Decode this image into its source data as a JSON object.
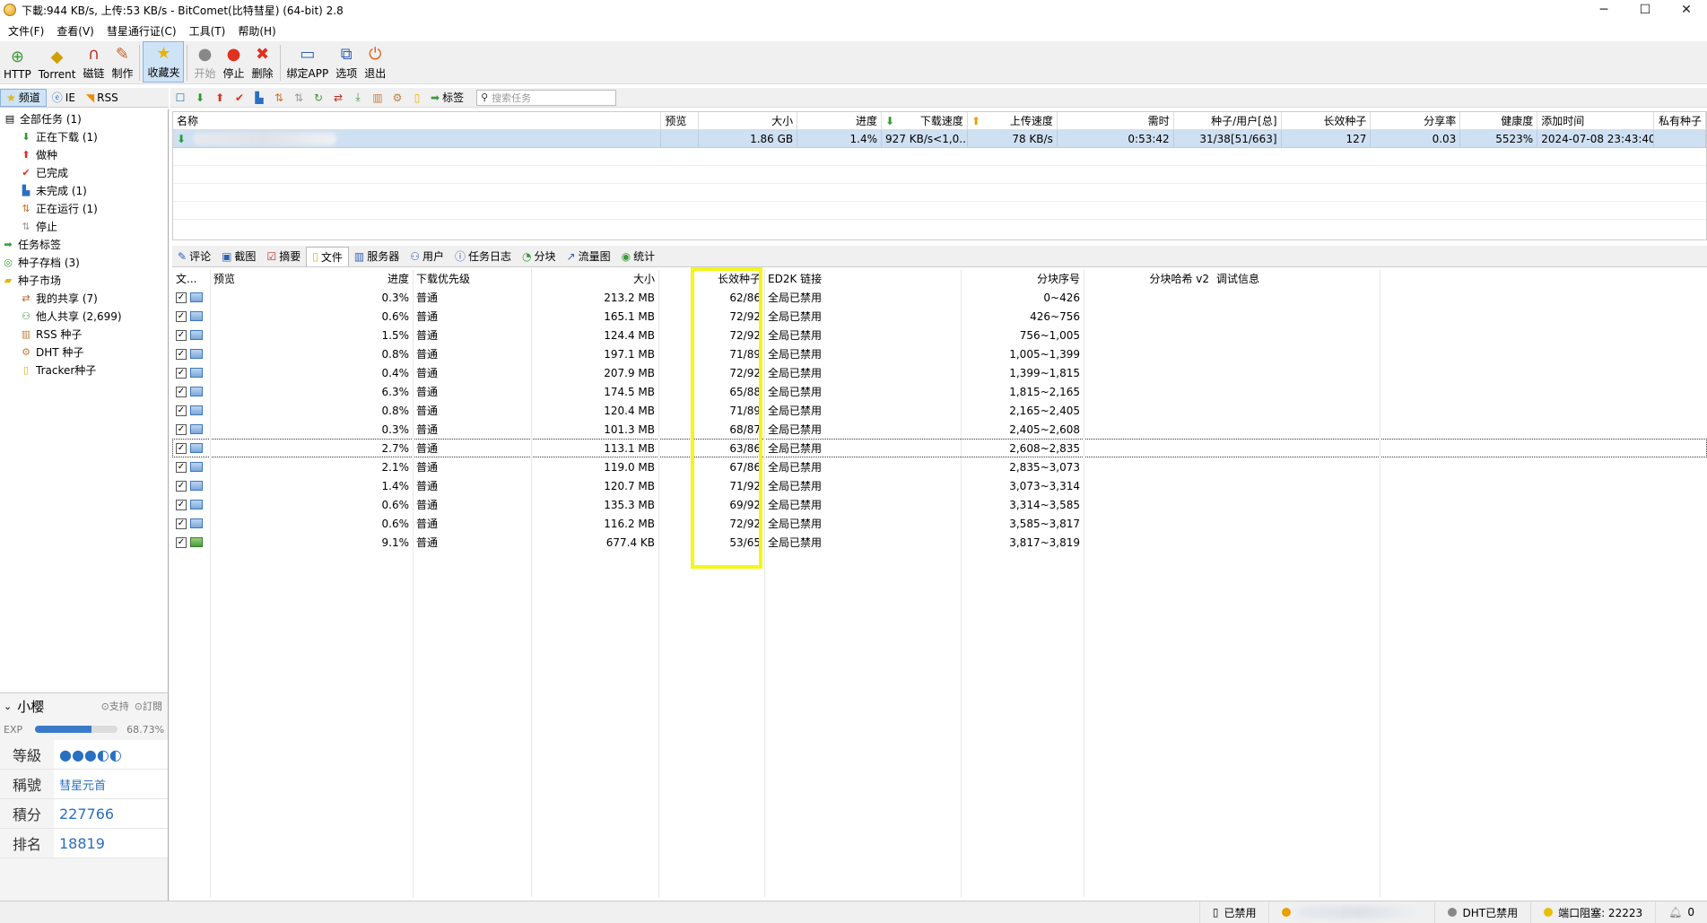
{
  "window": {
    "title": "下載:944 KB/s, 上传:53 KB/s - BitComet(比特彗星) (64-bit) 2.8"
  },
  "menu": [
    "文件(F)",
    "查看(V)",
    "彗星通行证(C)",
    "工具(T)",
    "帮助(H)"
  ],
  "toolbar": {
    "http": "HTTP",
    "torrent": "Torrent",
    "magnet": "磁链",
    "make": "制作",
    "favorites": "收藏夹",
    "start": "开始",
    "stop": "停止",
    "delete": "删除",
    "bind_app": "绑定APP",
    "options": "选项",
    "exit": "退出"
  },
  "side_tabs": {
    "channels": "频道",
    "ie": "IE",
    "rss": "RSS"
  },
  "tree": {
    "all": "全部任务 (1)",
    "downloading": "正在下载 (1)",
    "seeding": "做种",
    "completed": "已完成",
    "incomplete": "未完成 (1)",
    "running": "正在运行 (1)",
    "stopped": "停止",
    "task_tags": "任务标签",
    "torrent_archive": "种子存档 (3)",
    "market": "种子市场",
    "my_share": "我的共享 (7)",
    "others_share": "他人共享 (2,699)",
    "rss_seed": "RSS 种子",
    "dht_seed": "DHT 种子",
    "tracker_seed": "Tracker种子"
  },
  "profile": {
    "name": "小樱",
    "support": "支持",
    "subscribe": "訂閱",
    "exp_label": "EXP",
    "exp_percent": "68.73%",
    "exp_fraction": 0.6873,
    "level_label": "等級",
    "title_label": "稱號",
    "title_value": "彗星元首",
    "points_label": "積分",
    "points_value": "227766",
    "rank_label": "排名",
    "rank_value": "18819"
  },
  "subtool": {
    "tag_label": "标签",
    "search_placeholder": "搜索任务"
  },
  "task_columns": [
    "名称",
    "预览",
    "大小",
    "进度",
    "下载速度",
    "上传速度",
    "需时",
    "种子/用户[总]",
    "长效种子",
    "分享率",
    "健康度",
    "添加时间",
    "私有种子"
  ],
  "task": {
    "size": "1.86 GB",
    "progress": "1.4%",
    "down": "927 KB/s<1,0...",
    "up": "78 KB/s",
    "eta": "0:53:42",
    "seeds": "31/38[51/663]",
    "long_seeds": "127",
    "ratio": "0.03",
    "health": "5523%",
    "added": "2024-07-08 23:43:40"
  },
  "detail_tabs": [
    "评论",
    "截图",
    "摘要",
    "文件",
    "服务器",
    "用户",
    "任务日志",
    "分块",
    "流量图",
    "统计"
  ],
  "file_columns": [
    "文...",
    "预览",
    "进度",
    "下载优先级",
    "大小",
    "长效种子",
    "ED2K 链接",
    "分块序号",
    "分块哈希 v2",
    "调试信息"
  ],
  "files": [
    {
      "progress": "0.3%",
      "priority": "普通",
      "size": "213.2 MB",
      "seeds": "62/86",
      "ed2k": "全局已禁用",
      "pieces": "0~426"
    },
    {
      "progress": "0.6%",
      "priority": "普通",
      "size": "165.1 MB",
      "seeds": "72/92",
      "ed2k": "全局已禁用",
      "pieces": "426~756"
    },
    {
      "progress": "1.5%",
      "priority": "普通",
      "size": "124.4 MB",
      "seeds": "72/92",
      "ed2k": "全局已禁用",
      "pieces": "756~1,005"
    },
    {
      "progress": "0.8%",
      "priority": "普通",
      "size": "197.1 MB",
      "seeds": "71/89",
      "ed2k": "全局已禁用",
      "pieces": "1,005~1,399"
    },
    {
      "progress": "0.4%",
      "priority": "普通",
      "size": "207.9 MB",
      "seeds": "72/92",
      "ed2k": "全局已禁用",
      "pieces": "1,399~1,815"
    },
    {
      "progress": "6.3%",
      "priority": "普通",
      "size": "174.5 MB",
      "seeds": "65/88",
      "ed2k": "全局已禁用",
      "pieces": "1,815~2,165"
    },
    {
      "progress": "0.8%",
      "priority": "普通",
      "size": "120.4 MB",
      "seeds": "71/89",
      "ed2k": "全局已禁用",
      "pieces": "2,165~2,405"
    },
    {
      "progress": "0.3%",
      "priority": "普通",
      "size": "101.3 MB",
      "seeds": "68/87",
      "ed2k": "全局已禁用",
      "pieces": "2,405~2,608"
    },
    {
      "progress": "2.7%",
      "priority": "普通",
      "size": "113.1 MB",
      "seeds": "63/86",
      "ed2k": "全局已禁用",
      "pieces": "2,608~2,835"
    },
    {
      "progress": "2.1%",
      "priority": "普通",
      "size": "119.0 MB",
      "seeds": "67/86",
      "ed2k": "全局已禁用",
      "pieces": "2,835~3,073"
    },
    {
      "progress": "1.4%",
      "priority": "普通",
      "size": "120.7 MB",
      "seeds": "71/92",
      "ed2k": "全局已禁用",
      "pieces": "3,073~3,314"
    },
    {
      "progress": "0.6%",
      "priority": "普通",
      "size": "135.3 MB",
      "seeds": "69/92",
      "ed2k": "全局已禁用",
      "pieces": "3,314~3,585"
    },
    {
      "progress": "0.6%",
      "priority": "普通",
      "size": "116.2 MB",
      "seeds": "72/92",
      "ed2k": "全局已禁用",
      "pieces": "3,585~3,817"
    },
    {
      "progress": "9.1%",
      "priority": "普通",
      "size": "677.4 KB",
      "seeds": "53/65",
      "ed2k": "全局已禁用",
      "pieces": "3,817~3,819"
    }
  ],
  "status": {
    "disabled": "已禁用",
    "dht": "DHT已禁用",
    "port": "端口阻塞: 22223",
    "count": "0"
  },
  "colors": {
    "accent": "#cfe3f7",
    "highlight": "#f5f51a",
    "link": "#2a6fc1"
  }
}
